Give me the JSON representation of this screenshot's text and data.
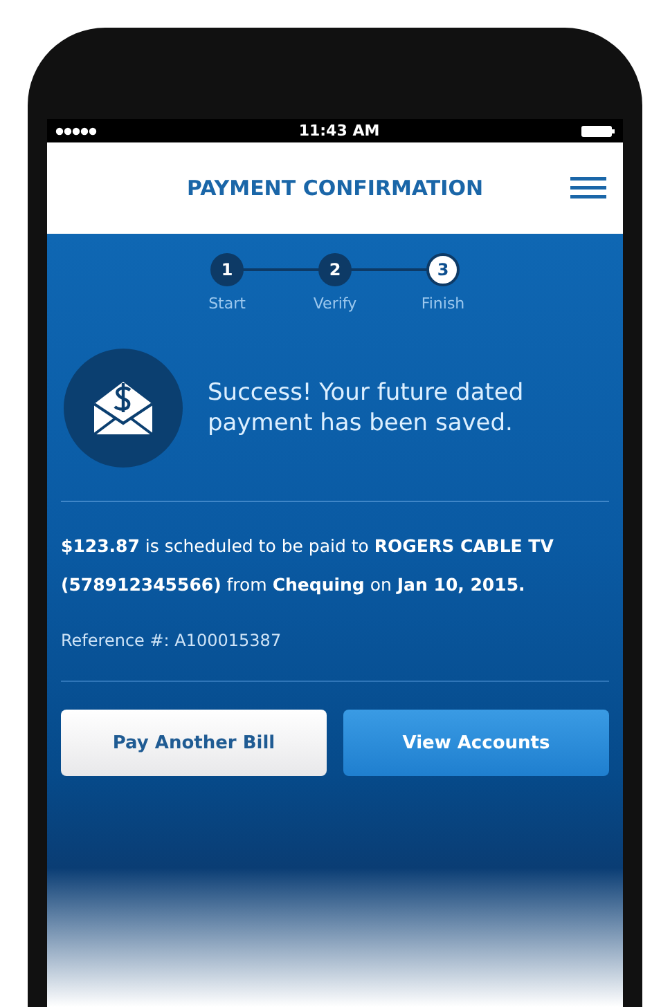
{
  "status_bar": {
    "time": "11:43 AM"
  },
  "header": {
    "title": "PAYMENT CONFIRMATION"
  },
  "steps": [
    {
      "number": "1",
      "label": "Start",
      "selected": false
    },
    {
      "number": "2",
      "label": "Verify",
      "selected": false
    },
    {
      "number": "3",
      "label": "Finish",
      "selected": true
    }
  ],
  "message": "Success! Your future dated payment has been saved.",
  "details": "**$123.87** is scheduled to be paid to **ROGERS CABLE TV (578912345566)** from **Chequing** on **Jan 10, 2015.**",
  "reference": "Reference #: A100015387",
  "buttons": [
    {
      "label": "Pay Another Bill",
      "kind": "secondary"
    },
    {
      "label": "View Accounts",
      "kind": "primary"
    }
  ]
}
